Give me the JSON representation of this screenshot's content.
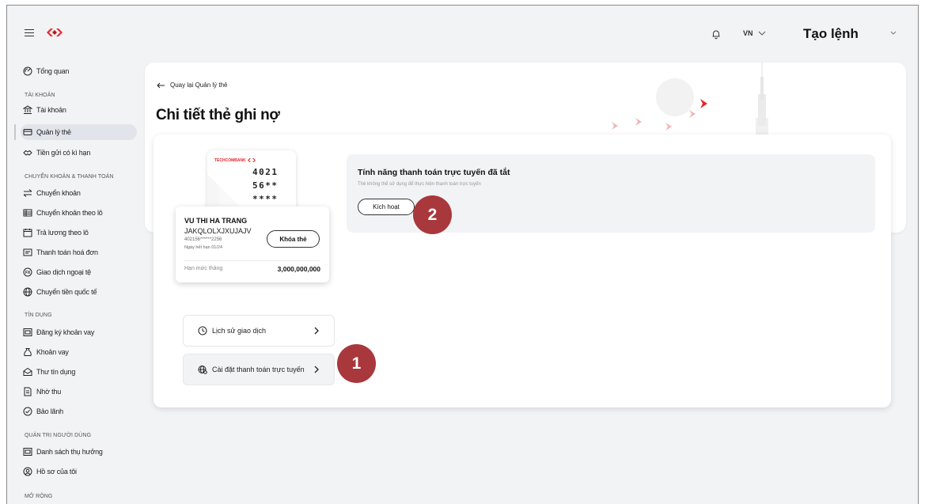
{
  "header": {
    "language": "VN",
    "title": "Tạo lệnh"
  },
  "sidebar": {
    "overview": "Tổng quan",
    "sections": [
      {
        "title": "TÀI KHOẢN",
        "items": [
          "Tài khoản",
          "Quản lý thẻ",
          "Tiền gửi có kì hạn"
        ]
      },
      {
        "title": "CHUYỂN KHOẢN & THANH TOÁN",
        "items": [
          "Chuyển khoản",
          "Chuyển khoản theo lô",
          "Trả lương theo lô",
          "Thanh toán hoá đơn",
          "Giao dịch ngoại tệ",
          "Chuyển tiền quốc tế"
        ]
      },
      {
        "title": "TÍN DỤNG",
        "items": [
          "Đăng ký khoản vay",
          "Khoản vay",
          "Thư tín dụng",
          "Nhờ thu",
          "Bảo lãnh"
        ]
      },
      {
        "title": "QUẢN TRỊ NGƯỜI DÙNG",
        "items": [
          "Danh sách thụ hưởng",
          "Hồ sơ của tôi"
        ]
      },
      {
        "title": "MỞ RỘNG",
        "items": []
      }
    ]
  },
  "main": {
    "back_link": "Quay lại Quản lý thẻ",
    "page_title": "Chi tiết thẻ ghi nợ"
  },
  "card": {
    "brand": "TECHCOMBANK",
    "back_numbers": [
      "4021",
      "56**",
      "****"
    ],
    "holder_name": "VU THI HA TRANG",
    "company": "JAKQLOLXJXUJAJV",
    "masked_number": "402156******2256",
    "expiry": "Ngày hết hạn 01/24",
    "lock_button": "Khóa thẻ",
    "limit_label": "Hạn mức tháng",
    "limit_value": "3,000,000,000"
  },
  "menu": {
    "history": "Lịch sử giao dịch",
    "online_settings": "Cài đặt thanh toán trực tuyến"
  },
  "online_payment": {
    "title": "Tính năng thanh toán trực tuyến đã tắt",
    "description": "Thẻ không thể sử dụng để thực hiện thanh toán trực tuyến",
    "activate_button": "Kích hoạt"
  },
  "annotations": {
    "step1": "1",
    "step2": "2"
  },
  "colors": {
    "brand_red": "#e8262b",
    "badge": "#a8383c"
  }
}
